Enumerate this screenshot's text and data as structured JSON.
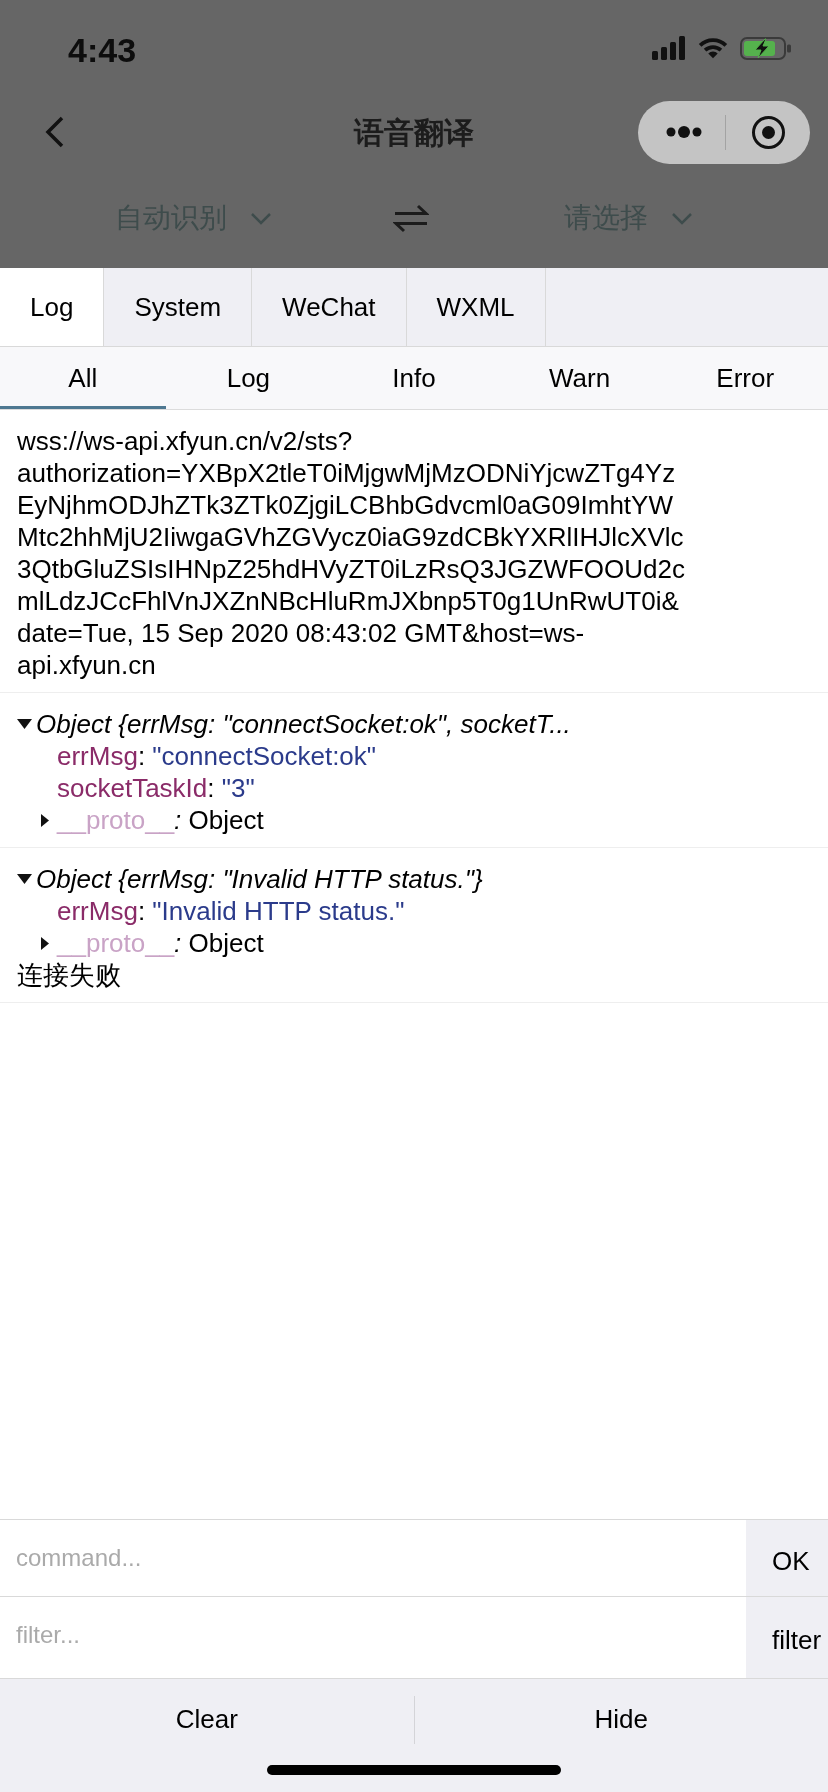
{
  "status_bar": {
    "time": "4:43"
  },
  "nav_bar": {
    "title": "语音翻译"
  },
  "language_bar": {
    "source": "自动识别",
    "target": "请选择"
  },
  "console": {
    "tabs": [
      {
        "label": "Log",
        "selected": true
      },
      {
        "label": "System",
        "selected": false
      },
      {
        "label": "WeChat",
        "selected": false
      },
      {
        "label": "WXML",
        "selected": false
      }
    ],
    "filters": [
      {
        "label": "All",
        "selected": true
      },
      {
        "label": "Log",
        "selected": false
      },
      {
        "label": "Info",
        "selected": false
      },
      {
        "label": "Warn",
        "selected": false
      },
      {
        "label": "Error",
        "selected": false
      }
    ],
    "entries": [
      {
        "items": [
          {
            "kind": "text",
            "text": "wss://ws-api.xfyun.cn/v2/sts?authorization=YXBpX2tleT0iMjgwMjMzODNiYjcwZTg4YzEyNjhmODJhZTk3ZTk0ZjgiLCBhbGdvcml0aG09ImhtYWMtc2hhMjU2IiwgaGVhZGVycz0iaG9zdCBkYXRlIHJlcXVlc3QtbGluZSIsIHNpZ25hdHVyZT0iLzRsQ3JGZWFOOUd2cmlLdzJCcFhlVnJXZnNBcHluRmJXbnp5T0g1UnRwUT0i&date=Tue, 15 Sep 2020 08:43:02 GMT&host=ws-api.xfyun.cn"
          }
        ]
      },
      {
        "items": [
          {
            "kind": "object",
            "summary": "Object {errMsg: \"connectSocket:ok\", socketT...",
            "expanded": true,
            "properties": [
              {
                "key": "errMsg",
                "separator": ": ",
                "value": "\"connectSocket:ok\""
              },
              {
                "key": "socketTaskId",
                "separator": ": ",
                "value": "\"3\""
              }
            ],
            "proto": {
              "key": "__proto__",
              "separator": ": ",
              "value": "Object",
              "expanded": false
            }
          }
        ]
      },
      {
        "items": [
          {
            "kind": "object",
            "summary": "Object {errMsg: \"Invalid HTTP status.\"}",
            "expanded": true,
            "properties": [
              {
                "key": "errMsg",
                "separator": ": ",
                "value": "\"Invalid HTTP status.\""
              }
            ],
            "proto": {
              "key": "__proto__",
              "separator": ": ",
              "value": "Object",
              "expanded": false
            }
          },
          {
            "kind": "text",
            "text": "连接失败"
          }
        ]
      }
    ],
    "command": {
      "placeholder": "command...",
      "button": "OK"
    },
    "filter": {
      "placeholder": "filter...",
      "button": "filter"
    },
    "toolbar": [
      "Clear",
      "Hide"
    ]
  }
}
